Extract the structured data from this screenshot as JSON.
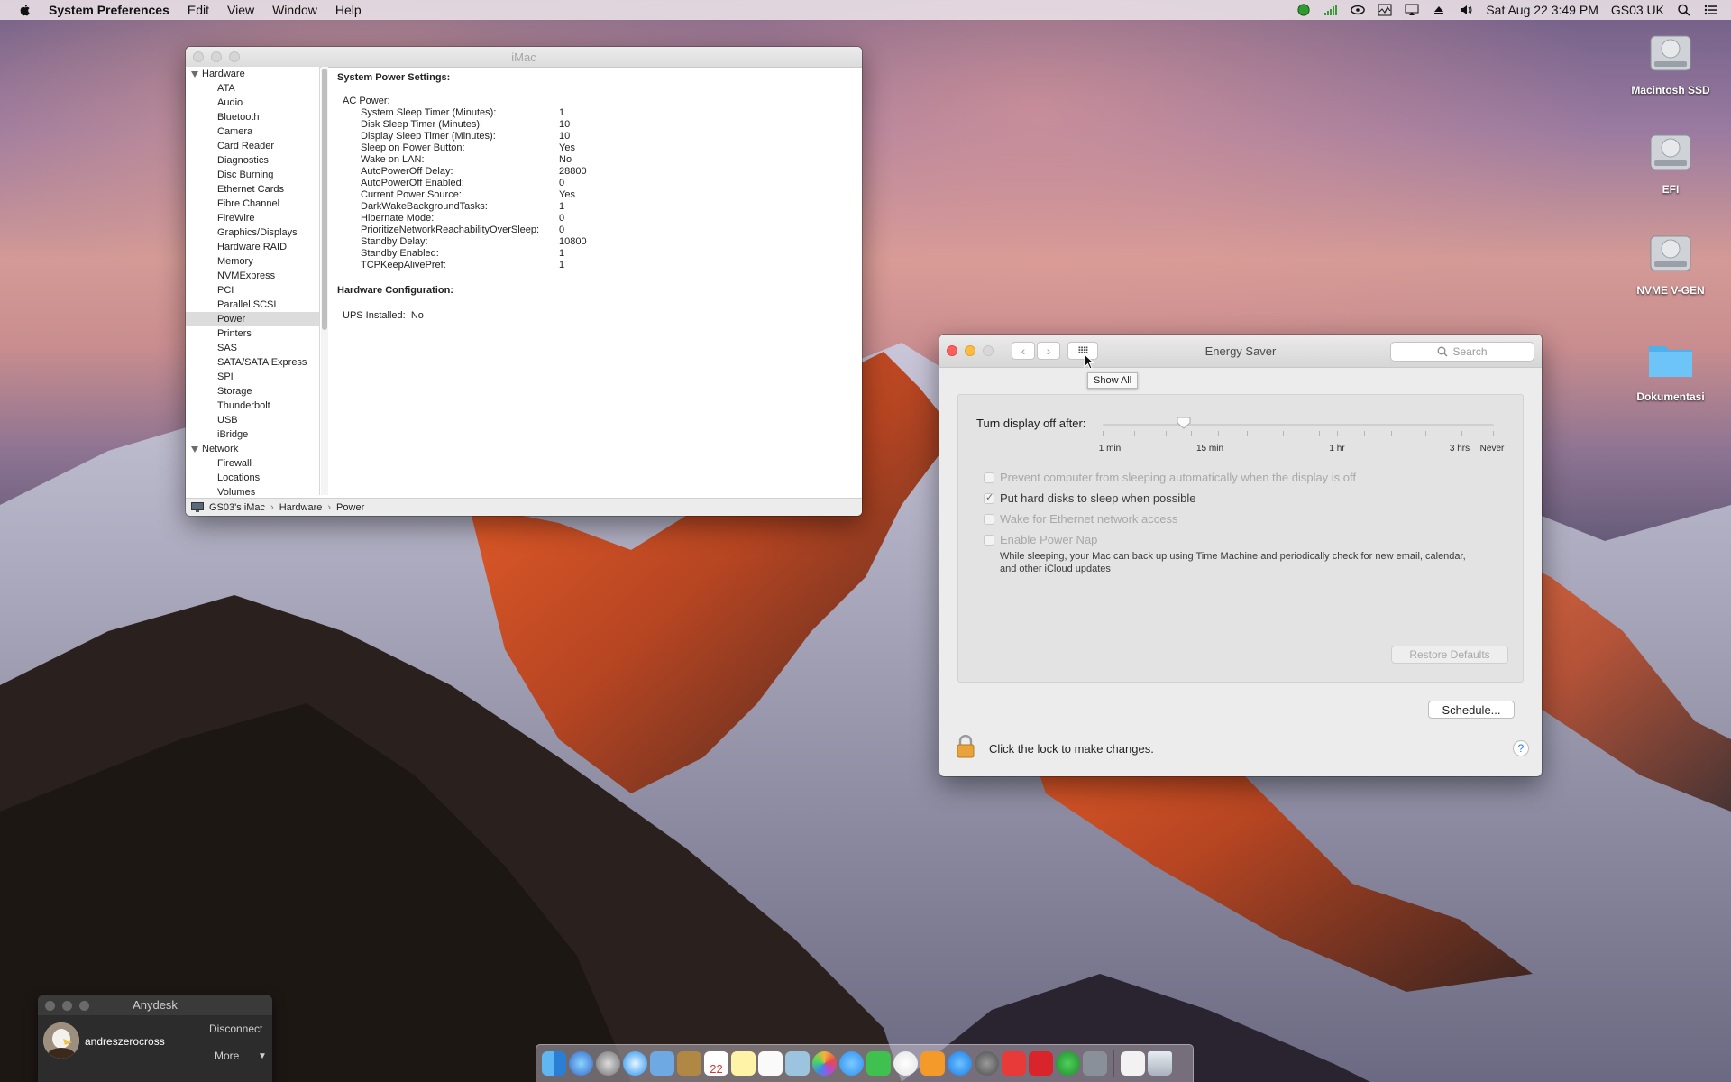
{
  "menubar": {
    "app_name": "System Preferences",
    "items": [
      "Edit",
      "View",
      "Window",
      "Help"
    ],
    "datetime": "Sat Aug 22  3:49 PM",
    "user": "GS03 UK"
  },
  "desktop": {
    "icons": [
      {
        "label": "Macintosh SSD"
      },
      {
        "label": "EFI"
      },
      {
        "label": "NVME V-GEN"
      },
      {
        "label": "Dokumentasi"
      }
    ]
  },
  "sysinfo": {
    "title": "iMac",
    "sidebar": {
      "hardware_label": "Hardware",
      "hardware_items": [
        "ATA",
        "Audio",
        "Bluetooth",
        "Camera",
        "Card Reader",
        "Diagnostics",
        "Disc Burning",
        "Ethernet Cards",
        "Fibre Channel",
        "FireWire",
        "Graphics/Displays",
        "Hardware RAID",
        "Memory",
        "NVMExpress",
        "PCI",
        "Parallel SCSI",
        "Power",
        "Printers",
        "SAS",
        "SATA/SATA Express",
        "SPI",
        "Storage",
        "Thunderbolt",
        "USB",
        "iBridge"
      ],
      "selected": "Power",
      "network_label": "Network",
      "network_items": [
        "Firewall",
        "Locations",
        "Volumes"
      ]
    },
    "main": {
      "heading": "System Power Settings:",
      "ac_power_label": "AC Power:",
      "rows": [
        {
          "k": "System Sleep Timer (Minutes):",
          "v": "1"
        },
        {
          "k": "Disk Sleep Timer (Minutes):",
          "v": "10"
        },
        {
          "k": "Display Sleep Timer (Minutes):",
          "v": "10"
        },
        {
          "k": "Sleep on Power Button:",
          "v": "Yes"
        },
        {
          "k": "Wake on LAN:",
          "v": "No"
        },
        {
          "k": "AutoPowerOff Delay:",
          "v": "28800"
        },
        {
          "k": "AutoPowerOff Enabled:",
          "v": "0"
        },
        {
          "k": "Current Power Source:",
          "v": "Yes"
        },
        {
          "k": "DarkWakeBackgroundTasks:",
          "v": "1"
        },
        {
          "k": "Hibernate Mode:",
          "v": "0"
        },
        {
          "k": "PrioritizeNetworkReachabilityOverSleep:",
          "v": "0"
        },
        {
          "k": "Standby Delay:",
          "v": "10800"
        },
        {
          "k": "Standby Enabled:",
          "v": "1"
        },
        {
          "k": "TCPKeepAlivePref:",
          "v": "1"
        }
      ],
      "hw_config_heading": "Hardware Configuration:",
      "ups_label": "UPS Installed:",
      "ups_value": "No"
    },
    "status": {
      "computer": "GS03's iMac",
      "crumb1": "Hardware",
      "crumb2": "Power"
    }
  },
  "energy": {
    "title": "Energy Saver",
    "search_placeholder": "Search",
    "tooltip": "Show All",
    "slider_label": "Turn display off after:",
    "slider_value_min": 10,
    "tick_labels": [
      "1 min",
      "15 min",
      "1 hr",
      "3 hrs",
      "Never"
    ],
    "checkboxes": [
      {
        "label": "Prevent computer from sleeping automatically when the display is off",
        "checked": false,
        "enabled": false
      },
      {
        "label": "Put hard disks to sleep when possible",
        "checked": true,
        "enabled": true
      },
      {
        "label": "Wake for Ethernet network access",
        "checked": false,
        "enabled": false
      },
      {
        "label": "Enable Power Nap",
        "checked": false,
        "enabled": false
      }
    ],
    "power_nap_desc": "While sleeping, your Mac can back up using Time Machine and periodically check for new email, calendar, and other iCloud updates",
    "restore_label": "Restore Defaults",
    "schedule_label": "Schedule...",
    "lock_text": "Click the lock to make changes.",
    "help_label": "?"
  },
  "anydesk": {
    "title": "Anydesk",
    "username": "andreszerocross",
    "disconnect": "Disconnect",
    "more": "More"
  },
  "dock": {
    "apps": [
      "finder",
      "siri",
      "launchpad",
      "safari",
      "mail-photo",
      "notes-brown",
      "calendar",
      "notes",
      "reminders",
      "photos-preview",
      "photos",
      "messages",
      "facetime",
      "itunes",
      "ibooks",
      "app-store",
      "system-preferences",
      "anydesk",
      "photo-booth",
      "spotify",
      "terminal",
      "documents",
      "trash"
    ],
    "calendar_day": "22"
  }
}
